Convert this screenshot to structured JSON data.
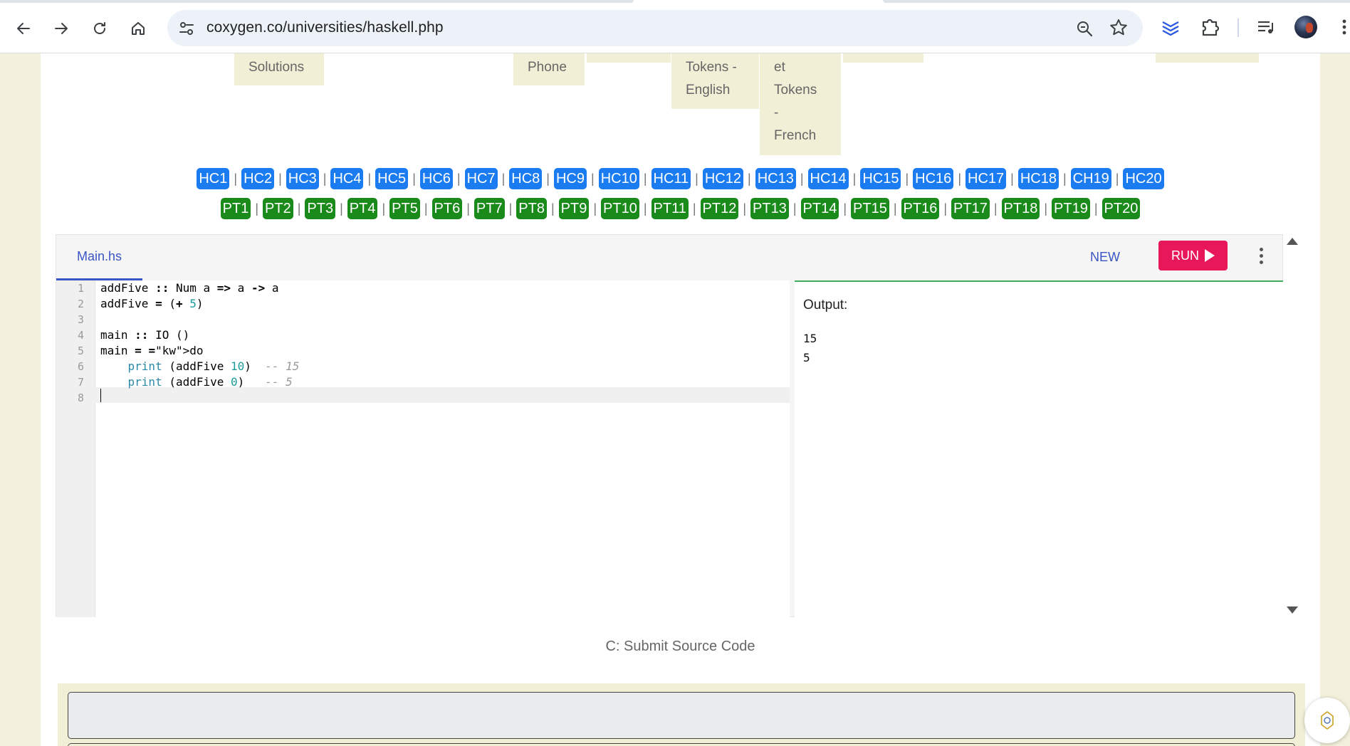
{
  "browser": {
    "url": "coxygen.co/universities/haskell.php"
  },
  "topnav": {
    "items": [
      {
        "label": "Solutions"
      },
      {
        "label": "Phone"
      },
      {
        "label": "Tokens -"
      },
      {
        "label": "English"
      },
      {
        "label": "et"
      },
      {
        "label": "Tokens"
      },
      {
        "label": "-"
      },
      {
        "label": "French"
      }
    ]
  },
  "hc_links": [
    "HC1",
    "HC2",
    "HC3",
    "HC4",
    "HC5",
    "HC6",
    "HC7",
    "HC8",
    "HC9",
    "HC10",
    "HC11",
    "HC12",
    "HC13",
    "HC14",
    "HC15",
    "HC16",
    "HC17",
    "HC18",
    "CH19",
    "HC20"
  ],
  "pt_links": [
    "PT1",
    "PT2",
    "PT3",
    "PT4",
    "PT5",
    "PT6",
    "PT7",
    "PT8",
    "PT9",
    "PT10",
    "PT11",
    "PT12",
    "PT13",
    "PT14",
    "PT15",
    "PT16",
    "PT17",
    "PT18",
    "PT19",
    "PT20"
  ],
  "separator": "|",
  "ide": {
    "file_tab": "Main.hs",
    "new_label": "NEW",
    "run_label": "RUN",
    "line_numbers": [
      "1",
      "2",
      "3",
      "4",
      "5",
      "6",
      "7",
      "8"
    ],
    "code_lines": [
      "addFive :: Num a => a -> a",
      "addFive = (+ 5)",
      "",
      "main :: IO ()",
      "main = do",
      "    print (addFive 10)  -- 15",
      "    print (addFive 0)   -- 5",
      ""
    ],
    "output_label": "Output:",
    "output_lines": [
      "15",
      "5"
    ]
  },
  "submit": {
    "title": "C: Submit Source Code"
  },
  "colors": {
    "hc_pill": "#1a7cf0",
    "pt_pill": "#1a8a1a",
    "run_button": "#e8175a",
    "accent": "#3a56c5",
    "page_bg": "#f3f1dc"
  }
}
